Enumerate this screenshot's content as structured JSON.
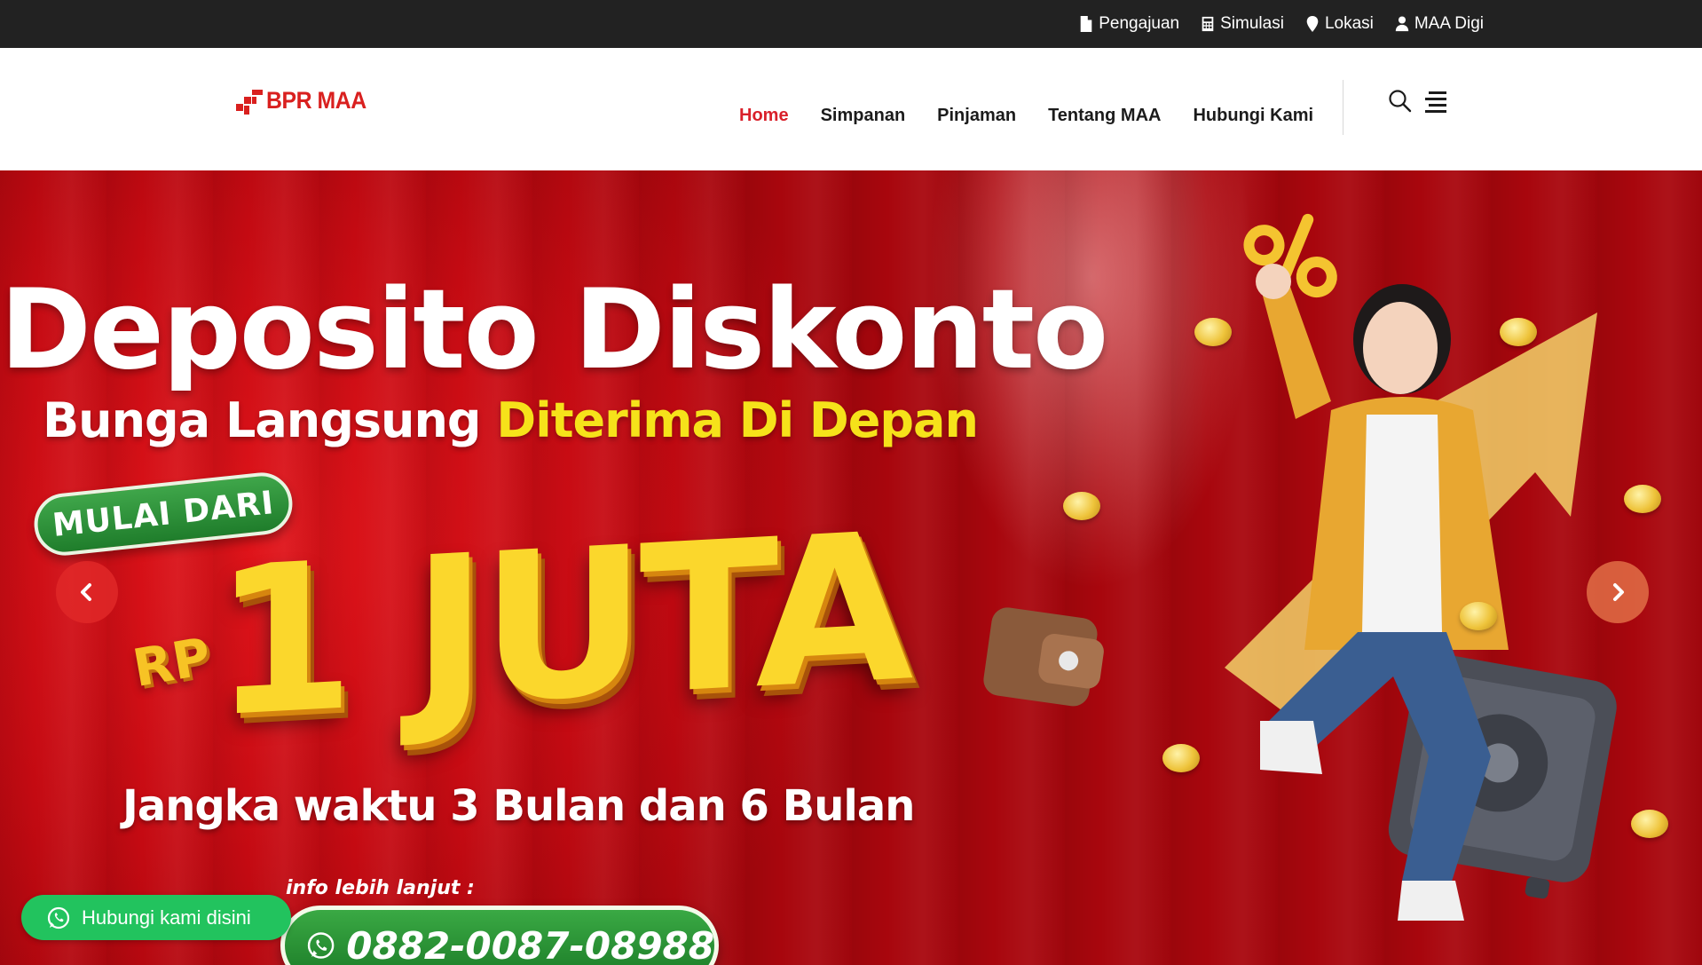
{
  "topbar": {
    "links": [
      {
        "label": "Pengajuan",
        "icon": "document-icon"
      },
      {
        "label": "Simulasi",
        "icon": "calculator-icon"
      },
      {
        "label": "Lokasi",
        "icon": "map-marker-icon"
      },
      {
        "label": "MAA Digi",
        "icon": "user-icon"
      }
    ]
  },
  "header": {
    "logo_text": "BPR MAA",
    "nav": [
      {
        "label": "Home",
        "active": true
      },
      {
        "label": "Simpanan",
        "active": false
      },
      {
        "label": "Pinjaman",
        "active": false
      },
      {
        "label": "Tentang MAA",
        "active": false
      },
      {
        "label": "Hubungi Kami",
        "active": false
      }
    ],
    "icons": [
      "search-icon",
      "menu-icon"
    ]
  },
  "hero": {
    "title": "Deposito Diskonto",
    "subtitle_white": "Bunga Langsung ",
    "subtitle_yellow": "Diterima Di Depan",
    "badge": "MULAI DARI",
    "currency": "RP",
    "amount": "1 JUTA",
    "term": "Jangka waktu 3 Bulan dan 6 Bulan",
    "info_label": "info lebih lanjut :",
    "phone": "0882-0087-08988"
  },
  "float_whatsapp": {
    "label": "Hubungi kami disini"
  },
  "colors": {
    "brand_red": "#d9202a",
    "topbar_bg": "#222222",
    "whatsapp_green": "#22c35e",
    "highlight_yellow": "#f6e21a"
  }
}
